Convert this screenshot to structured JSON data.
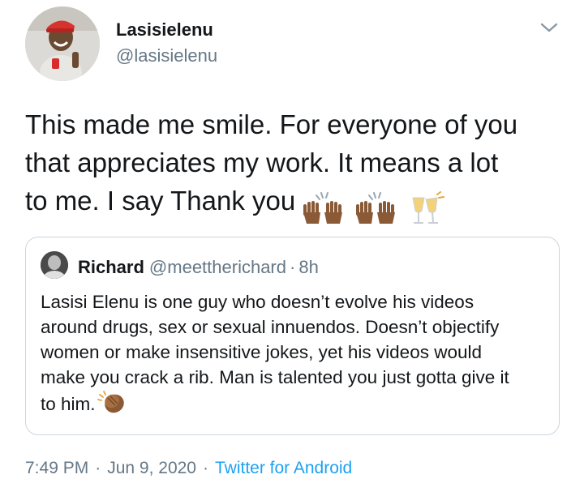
{
  "author": {
    "name": "Lasisielenu",
    "handle": "@lasisielenu"
  },
  "tweet": {
    "lines": [
      "This made me smile. For everyone of you",
      "that appreciates my work. It means a lot",
      "to me. I say Thank you"
    ],
    "emojis": [
      "raising-hands-emoji",
      "raising-hands-emoji",
      "clinking-glasses-emoji"
    ]
  },
  "quoted": {
    "name": "Richard",
    "handle": "@meettherichard",
    "separator": "·",
    "time": "8h",
    "lines": [
      "Lasisi Elenu is one guy who doesn’t evolve his videos",
      "around drugs, sex or sexual innuendos. Doesn’t objectify",
      "women or make insensitive jokes, yet his videos would",
      "make you crack a rib. Man is talented you just gotta give it",
      "to him."
    ],
    "emojis": [
      "clapping-hands-emoji"
    ]
  },
  "meta": {
    "time": "7:49 PM",
    "date": "Jun 9, 2020",
    "separator": "·",
    "source": "Twitter for Android"
  },
  "colors": {
    "text": "#14171a",
    "secondary": "#657786",
    "link": "#1da1f2",
    "border": "#ccd6dd"
  }
}
